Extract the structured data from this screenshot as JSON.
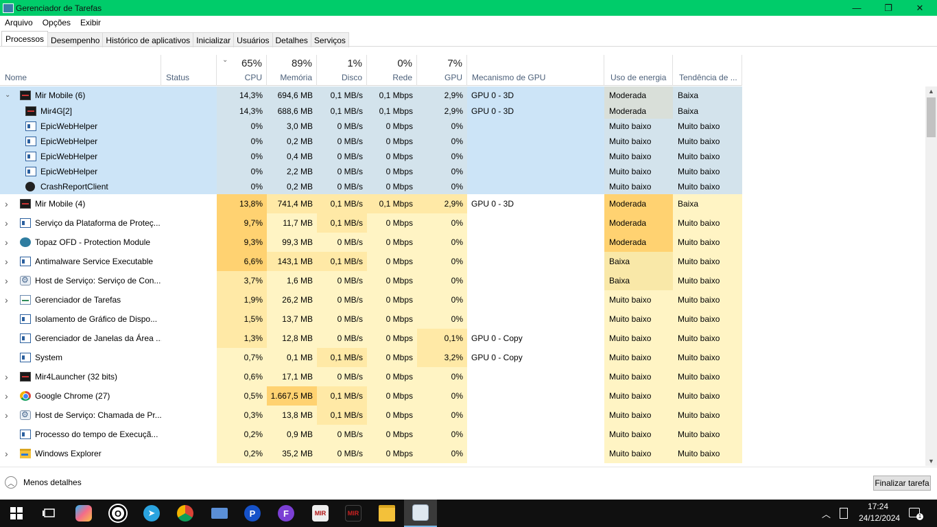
{
  "window": {
    "title": "Gerenciador de Tarefas",
    "minimize": "—",
    "maximize": "❐",
    "close": "✕"
  },
  "menu": [
    "Arquivo",
    "Opções",
    "Exibir"
  ],
  "tabs": [
    "Processos",
    "Desempenho",
    "Histórico de aplicativos",
    "Inicializar",
    "Usuários",
    "Detalhes",
    "Serviços"
  ],
  "header": {
    "name": "Nome",
    "status": "Status",
    "cpu_pct": "65%",
    "cpu": "CPU",
    "mem_pct": "89%",
    "mem": "Memória",
    "disk_pct": "1%",
    "disk": "Disco",
    "net_pct": "0%",
    "net": "Rede",
    "gpu_pct": "7%",
    "gpu": "GPU",
    "gpu_engine": "Mecanismo de GPU",
    "power": "Uso de energia",
    "power_trend": "Tendência de ..."
  },
  "rows": [
    {
      "name": "Mir Mobile (6)",
      "icon": "mir",
      "expand": "open",
      "group": true,
      "cpu": "14,3%",
      "mem": "694,6 MB",
      "disk": "0,1 MB/s",
      "net": "0,1 Mbps",
      "gpu": "2,9%",
      "engine": "GPU 0 - 3D",
      "power": "Moderada",
      "trend": "Baixa"
    },
    {
      "name": "Mir4G[2]",
      "icon": "mir",
      "child": true,
      "group": true,
      "cpu": "14,3%",
      "mem": "688,6 MB",
      "disk": "0,1 MB/s",
      "net": "0,1 Mbps",
      "gpu": "2,9%",
      "engine": "GPU 0 - 3D",
      "power": "Moderada",
      "trend": "Baixa"
    },
    {
      "name": "EpicWebHelper",
      "icon": "win",
      "child": true,
      "group": true,
      "cpu": "0%",
      "mem": "3,0 MB",
      "disk": "0 MB/s",
      "net": "0 Mbps",
      "gpu": "0%",
      "engine": "",
      "power": "Muito baixo",
      "trend": "Muito baixo"
    },
    {
      "name": "EpicWebHelper",
      "icon": "win",
      "child": true,
      "group": true,
      "cpu": "0%",
      "mem": "0,2 MB",
      "disk": "0 MB/s",
      "net": "0 Mbps",
      "gpu": "0%",
      "engine": "",
      "power": "Muito baixo",
      "trend": "Muito baixo"
    },
    {
      "name": "EpicWebHelper",
      "icon": "win",
      "child": true,
      "group": true,
      "cpu": "0%",
      "mem": "0,4 MB",
      "disk": "0 MB/s",
      "net": "0 Mbps",
      "gpu": "0%",
      "engine": "",
      "power": "Muito baixo",
      "trend": "Muito baixo"
    },
    {
      "name": "EpicWebHelper",
      "icon": "win",
      "child": true,
      "group": true,
      "cpu": "0%",
      "mem": "2,2 MB",
      "disk": "0 MB/s",
      "net": "0 Mbps",
      "gpu": "0%",
      "engine": "",
      "power": "Muito baixo",
      "trend": "Muito baixo"
    },
    {
      "name": "CrashReportClient",
      "icon": "ue",
      "child": true,
      "group": true,
      "cpu": "0%",
      "mem": "0,2 MB",
      "disk": "0 MB/s",
      "net": "0 Mbps",
      "gpu": "0%",
      "engine": "",
      "power": "Muito baixo",
      "trend": "Muito baixo"
    },
    {
      "name": "Mir Mobile (4)",
      "icon": "mir",
      "expand": "closed",
      "cpu": "13,8%",
      "mem": "741,4 MB",
      "disk": "0,1 MB/s",
      "net": "0,1 Mbps",
      "gpu": "2,9%",
      "engine": "GPU 0 - 3D",
      "power": "Moderada",
      "trend": "Baixa"
    },
    {
      "name": "Serviço da Plataforma de Proteç...",
      "icon": "win",
      "expand": "closed",
      "cpu": "9,7%",
      "mem": "11,7 MB",
      "disk": "0,1 MB/s",
      "net": "0 Mbps",
      "gpu": "0%",
      "engine": "",
      "power": "Moderada",
      "trend": "Muito baixo"
    },
    {
      "name": "Topaz OFD - Protection Module",
      "icon": "topaz",
      "expand": "closed",
      "cpu": "9,3%",
      "mem": "99,3 MB",
      "disk": "0 MB/s",
      "net": "0 Mbps",
      "gpu": "0%",
      "engine": "",
      "power": "Moderada",
      "trend": "Muito baixo"
    },
    {
      "name": "Antimalware Service Executable",
      "icon": "win",
      "expand": "closed",
      "cpu": "6,6%",
      "mem": "143,1 MB",
      "disk": "0,1 MB/s",
      "net": "0 Mbps",
      "gpu": "0%",
      "engine": "",
      "power": "Baixa",
      "trend": "Muito baixo"
    },
    {
      "name": "Host de Serviço: Serviço de Con...",
      "icon": "gear",
      "expand": "closed",
      "cpu": "3,7%",
      "mem": "1,6 MB",
      "disk": "0 MB/s",
      "net": "0 Mbps",
      "gpu": "0%",
      "engine": "",
      "power": "Baixa",
      "trend": "Muito baixo"
    },
    {
      "name": "Gerenciador de Tarefas",
      "icon": "tm",
      "expand": "closed",
      "cpu": "1,9%",
      "mem": "26,2 MB",
      "disk": "0 MB/s",
      "net": "0 Mbps",
      "gpu": "0%",
      "engine": "",
      "power": "Muito baixo",
      "trend": "Muito baixo"
    },
    {
      "name": "Isolamento de Gráfico de Dispo...",
      "icon": "win",
      "cpu": "1,5%",
      "mem": "13,7 MB",
      "disk": "0 MB/s",
      "net": "0 Mbps",
      "gpu": "0%",
      "engine": "",
      "power": "Muito baixo",
      "trend": "Muito baixo"
    },
    {
      "name": "Gerenciador de Janelas da Área ...",
      "icon": "win",
      "cpu": "1,3%",
      "mem": "12,8 MB",
      "disk": "0 MB/s",
      "net": "0 Mbps",
      "gpu": "0,1%",
      "engine": "GPU 0 - Copy",
      "power": "Muito baixo",
      "trend": "Muito baixo"
    },
    {
      "name": "System",
      "icon": "win",
      "cpu": "0,7%",
      "mem": "0,1 MB",
      "disk": "0,1 MB/s",
      "net": "0 Mbps",
      "gpu": "3,2%",
      "engine": "GPU 0 - Copy",
      "power": "Muito baixo",
      "trend": "Muito baixo"
    },
    {
      "name": "Mir4Launcher (32 bits)",
      "icon": "mir",
      "expand": "closed",
      "cpu": "0,6%",
      "mem": "17,1 MB",
      "disk": "0 MB/s",
      "net": "0 Mbps",
      "gpu": "0%",
      "engine": "",
      "power": "Muito baixo",
      "trend": "Muito baixo"
    },
    {
      "name": "Google Chrome (27)",
      "icon": "chrome",
      "expand": "closed",
      "cpu": "0,5%",
      "mem": "1.667,5 MB",
      "disk": "0,1 MB/s",
      "net": "0 Mbps",
      "gpu": "0%",
      "engine": "",
      "power": "Muito baixo",
      "trend": "Muito baixo"
    },
    {
      "name": "Host de Serviço: Chamada de Pr...",
      "icon": "gear",
      "expand": "closed",
      "cpu": "0,3%",
      "mem": "13,8 MB",
      "disk": "0,1 MB/s",
      "net": "0 Mbps",
      "gpu": "0%",
      "engine": "",
      "power": "Muito baixo",
      "trend": "Muito baixo"
    },
    {
      "name": "Processo do tempo de Execuçã...",
      "icon": "win",
      "cpu": "0,2%",
      "mem": "0,9 MB",
      "disk": "0 MB/s",
      "net": "0 Mbps",
      "gpu": "0%",
      "engine": "",
      "power": "Muito baixo",
      "trend": "Muito baixo"
    },
    {
      "name": "Windows Explorer",
      "icon": "folder",
      "expand": "closed",
      "cpu": "0,2%",
      "mem": "35,2 MB",
      "disk": "0 MB/s",
      "net": "0 Mbps",
      "gpu": "0%",
      "engine": "",
      "power": "Muito baixo",
      "trend": "Muito baixo"
    }
  ],
  "footer": {
    "less_details": "Menos detalhes",
    "end_task": "Finalizar tarefa"
  },
  "taskbar": {
    "icons": [
      "start-icon",
      "task-view-icon",
      "copilot-icon",
      "opera-icon",
      "telegram-icon",
      "chrome-icon",
      "laptop-icon",
      "p-app-icon",
      "f-app-icon",
      "mir4-icon",
      "mir4-icon",
      "file-explorer-icon",
      "task-manager-icon"
    ],
    "time": "17:24",
    "date": "24/12/2024"
  },
  "colors": {
    "titlebar": "#00cc6a",
    "selected_group": "#cce4f7",
    "heat_low": "#fff4c4",
    "heat_mid": "#ffe9a6",
    "heat_high": "#ffd271"
  }
}
